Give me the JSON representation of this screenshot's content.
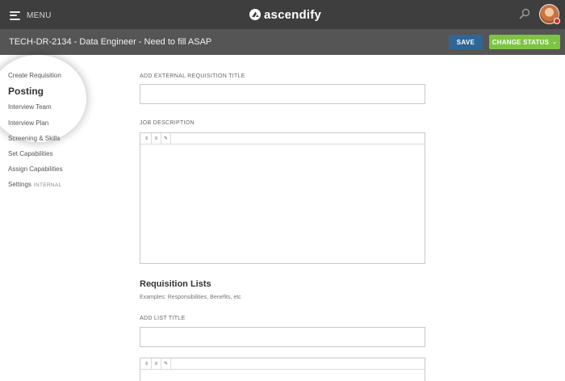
{
  "header": {
    "menu_label": "MENU",
    "logo_text": "ascendify",
    "icons": {
      "menu": "hamburger-icon",
      "logo": "ascendify-logo-icon",
      "search": "search-icon",
      "avatar": "user-avatar"
    },
    "colors": {
      "topbar": "#3e3e3e",
      "subbar": "#555555",
      "save": "#2f6697",
      "status": "#7ec443",
      "notification_dot": "#d0312d"
    }
  },
  "requisition": {
    "title": "TECH-DR-2134 - Data Engineer - Need to fill ASAP",
    "save_label": "SAVE",
    "change_status_label": "CHANGE STATUS"
  },
  "sidebar": {
    "items": [
      {
        "label": "Create Requisition"
      },
      {
        "label": "Posting",
        "active": true
      },
      {
        "label": "Interview Team"
      },
      {
        "label": "Interview Plan"
      },
      {
        "label": "Screening & Skills"
      },
      {
        "label": "Set Capabilities"
      },
      {
        "label": "Assign Capabilities"
      },
      {
        "label": "Settings",
        "tag": "INTERNAL"
      }
    ]
  },
  "form": {
    "external_title_label": "ADD EXTERNAL REQUISITION TITLE",
    "external_title_value": "",
    "job_description_label": "JOB DESCRIPTION",
    "editor_toolbar": [
      "bullet-list-icon",
      "numbered-list-icon",
      "link-icon"
    ],
    "lists_heading": "Requisition Lists",
    "lists_hint": "Examples: Responsibilities, Benefits, etc",
    "list_title_label": "ADD LIST TITLE",
    "list_title_value": ""
  }
}
